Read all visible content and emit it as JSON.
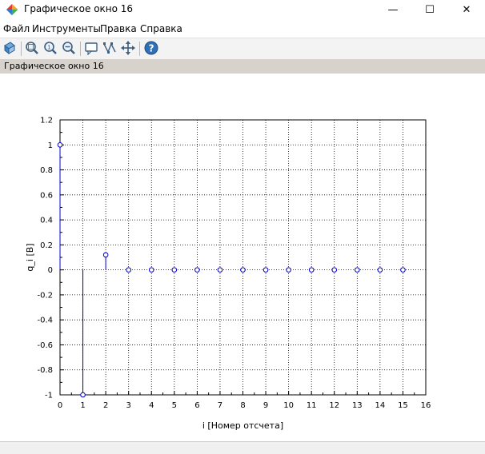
{
  "window": {
    "title": "Графическое окно 16",
    "minimize": "—",
    "maximize": "☐",
    "close": "✕"
  },
  "menu": {
    "items": [
      "Файл",
      "Инструменты",
      "Правка",
      "Справка"
    ]
  },
  "toolbar": {
    "icons": [
      "rotate-icon",
      "zoom-in-icon",
      "zoom-fit-icon",
      "zoom-out-icon",
      "data-tip-icon",
      "edit-curve-icon",
      "pan-icon",
      "help-icon"
    ]
  },
  "figure": {
    "label": "Графическое окно 16"
  },
  "colors": {
    "stem": "#0000cc",
    "figure_bar": "#d7d3cc"
  },
  "chart_data": {
    "type": "stem",
    "x": [
      0,
      1,
      2,
      3,
      4,
      5,
      6,
      7,
      8,
      9,
      10,
      11,
      12,
      13,
      14,
      15
    ],
    "y": [
      1,
      -1,
      0.12,
      0,
      0,
      0,
      0,
      0,
      0,
      0,
      0,
      0,
      0,
      0,
      0,
      0
    ],
    "xlabel": "i [Номер отсчета]",
    "ylabel": "q_i [B]",
    "xlim": [
      0,
      16
    ],
    "ylim": [
      -1,
      1.2
    ],
    "xticks": [
      "0",
      "1",
      "2",
      "3",
      "4",
      "5",
      "6",
      "7",
      "8",
      "9",
      "10",
      "11",
      "12",
      "13",
      "14",
      "15",
      "16"
    ],
    "yticks": [
      "1.2",
      "1",
      "0.8",
      "0.6",
      "0.4",
      "0.2",
      "0",
      "-0.2",
      "-0.4",
      "-0.6",
      "-0.8",
      "-1"
    ],
    "grid": true
  }
}
